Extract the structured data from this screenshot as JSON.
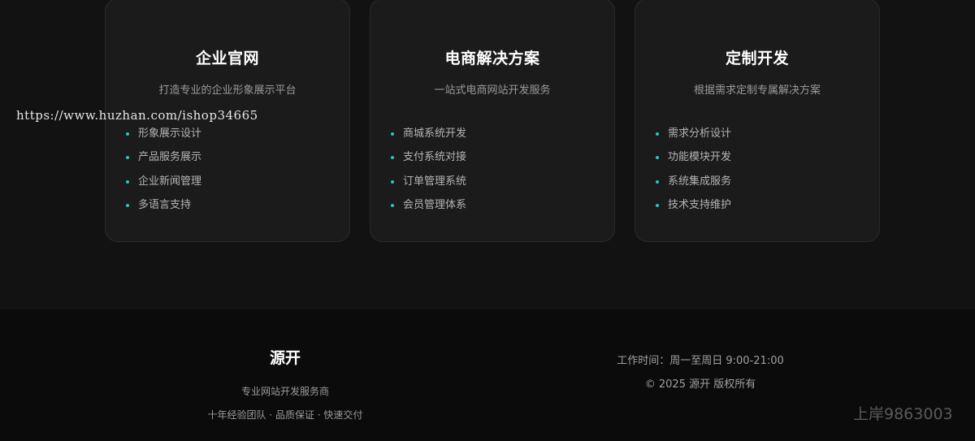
{
  "watermark_url": "https://www.huzhan.com/ishop34665",
  "accent_color": "#1fc8c0",
  "services": [
    {
      "title": "企业官网",
      "description": "打造专业的企业形象展示平台",
      "features": [
        "形象展示设计",
        "产品服务展示",
        "企业新闻管理",
        "多语言支持"
      ]
    },
    {
      "title": "电商解决方案",
      "description": "一站式电商网站开发服务",
      "features": [
        "商城系统开发",
        "支付系统对接",
        "订单管理系统",
        "会员管理体系"
      ]
    },
    {
      "title": "定制开发",
      "description": "根据需求定制专属解决方案",
      "features": [
        "需求分析设计",
        "功能模块开发",
        "系统集成服务",
        "技术支持维护"
      ]
    }
  ],
  "footer": {
    "brand": "源开",
    "tagline": "专业网站开发服务商",
    "features": "十年经验团队 · 品质保证 · 快速交付",
    "hours": "工作时间：周一至周日 9:00-21:00",
    "copyright": "© 2025 源开 版权所有",
    "watermark": "上岸9863003"
  }
}
